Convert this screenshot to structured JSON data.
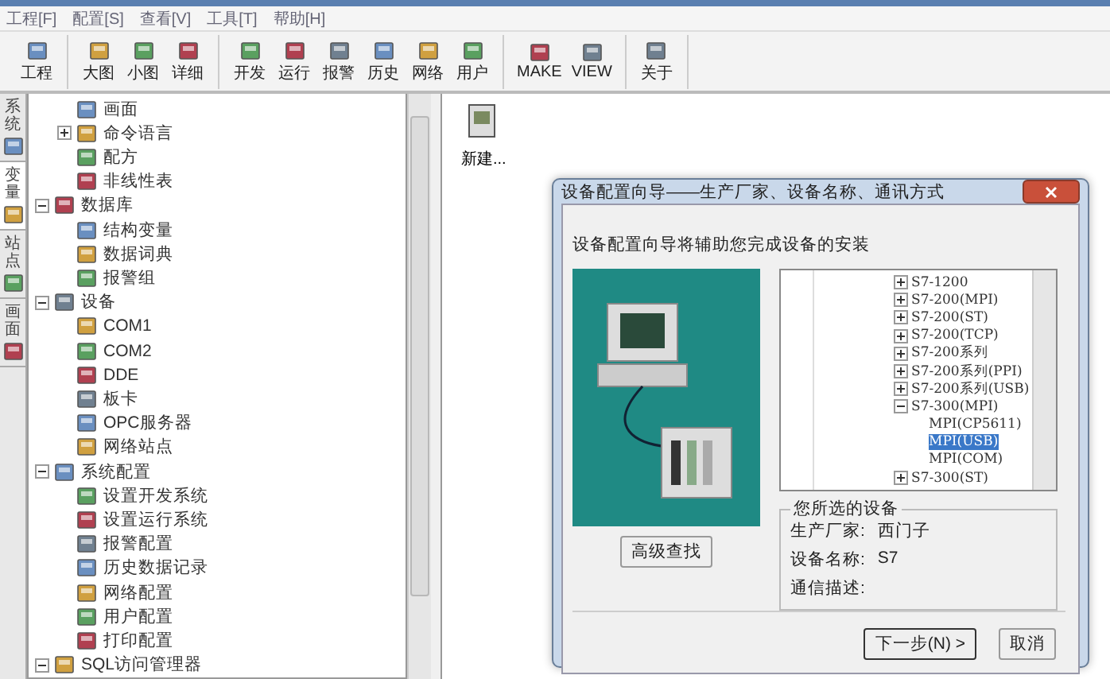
{
  "menu": [
    {
      "label": "工程[F]"
    },
    {
      "label": "配置[S]"
    },
    {
      "label": "查看[V]"
    },
    {
      "label": "工具[T]"
    },
    {
      "label": "帮助[H]"
    }
  ],
  "toolbar": [
    [
      {
        "label": "工程"
      }
    ],
    [
      {
        "label": "大图"
      },
      {
        "label": "小图"
      },
      {
        "label": "详细"
      }
    ],
    [
      {
        "label": "开发"
      },
      {
        "label": "运行"
      },
      {
        "label": "报警"
      },
      {
        "label": "历史"
      },
      {
        "label": "网络"
      },
      {
        "label": "用户"
      }
    ],
    [
      {
        "label": "MAKE"
      },
      {
        "label": "VIEW"
      }
    ],
    [
      {
        "label": "关于"
      }
    ]
  ],
  "side_tabs": [
    {
      "label": "系统",
      "selected": false
    },
    {
      "label": "变量",
      "selected": true
    },
    {
      "label": "站点",
      "selected": false
    },
    {
      "label": "画面",
      "selected": false
    }
  ],
  "tree": {
    "partial_parent_children": [
      {
        "label": "画面"
      },
      {
        "label": "命令语言",
        "expanded": false
      },
      {
        "label": "配方"
      },
      {
        "label": "非线性表"
      }
    ],
    "items": [
      {
        "label": "数据库",
        "expanded": true,
        "children": [
          {
            "label": "结构变量"
          },
          {
            "label": "数据词典"
          },
          {
            "label": "报警组"
          }
        ]
      },
      {
        "label": "设备",
        "expanded": true,
        "children": [
          {
            "label": "COM1"
          },
          {
            "label": "COM2"
          },
          {
            "label": "DDE"
          },
          {
            "label": "板卡"
          },
          {
            "label": "OPC服务器"
          },
          {
            "label": "网络站点"
          }
        ]
      },
      {
        "label": "系统配置",
        "expanded": true,
        "children": [
          {
            "label": "设置开发系统"
          },
          {
            "label": "设置运行系统"
          },
          {
            "label": "报警配置"
          },
          {
            "label": "历史数据记录"
          },
          {
            "label": "网络配置"
          },
          {
            "label": "用户配置"
          },
          {
            "label": "打印配置"
          }
        ]
      },
      {
        "label": "SQL访问管理器",
        "expanded": true
      }
    ]
  },
  "content_items": [
    {
      "label": "新建..."
    }
  ],
  "dialog": {
    "title": "设备配置向导——生产厂家、设备名称、通讯方式",
    "intro": "设备配置向导将辅助您完成设备的安装",
    "search_button": "高级查找",
    "device_tree": [
      {
        "label": "S7-1200",
        "expanded": false,
        "selected": false
      },
      {
        "label": "S7-200(MPI)",
        "expanded": false,
        "selected": false
      },
      {
        "label": "S7-200(ST)",
        "expanded": false,
        "selected": false
      },
      {
        "label": "S7-200(TCP)",
        "expanded": false,
        "selected": false
      },
      {
        "label": "S7-200系列",
        "expanded": false,
        "selected": false
      },
      {
        "label": "S7-200系列(PPI)",
        "expanded": false,
        "selected": false
      },
      {
        "label": "S7-200系列(USB)",
        "expanded": false,
        "selected": false
      },
      {
        "label": "S7-300(MPI)",
        "expanded": true,
        "selected": false,
        "children": [
          {
            "label": "MPI(CP5611)",
            "selected": false
          },
          {
            "label": "MPI(USB)",
            "selected": true
          },
          {
            "label": "MPI(COM)",
            "selected": false
          }
        ]
      },
      {
        "label": "S7-300(ST)",
        "expanded": false,
        "selected": false
      }
    ],
    "selection": {
      "title": "您所选的设备",
      "fields": [
        {
          "label": "生产厂家:",
          "value": "西门子"
        },
        {
          "label": "设备名称:",
          "value": "S7"
        },
        {
          "label": "通信描述:"
        }
      ]
    },
    "buttons": [
      {
        "label": "下一步(N) >",
        "kind": "primary"
      },
      {
        "label": "取消",
        "kind": "plain"
      }
    ]
  }
}
